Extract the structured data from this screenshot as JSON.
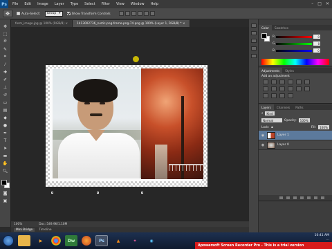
{
  "app": {
    "logo": "Ps"
  },
  "menu": [
    "File",
    "Edit",
    "Image",
    "Layer",
    "Type",
    "Select",
    "Filter",
    "View",
    "Window",
    "Help"
  ],
  "window_controls": [
    "–",
    "□",
    "✕"
  ],
  "options_bar": {
    "auto_select_label": "Auto-Select:",
    "auto_select_checked": false,
    "group_value": "Group",
    "show_transform_label": "Show Transform Controls",
    "show_transform_checked": true
  },
  "tabs": [
    {
      "label": "form_image.jpg @ 100% (RGB/8) ×",
      "active": false
    },
    {
      "label": "1413002736_rustic-png-frame-png-74.png @ 100% (Layer 1, RGB/8) * ×",
      "active": true
    }
  ],
  "status": {
    "zoom": "100%",
    "doc": "Doc: 549.9K/1.10M"
  },
  "bottom_tabs": [
    "Mini Bridge",
    "Timeline"
  ],
  "color_panel": {
    "tabs": [
      "Color",
      "Swatches"
    ],
    "channels": [
      {
        "name": "R",
        "value": "0"
      },
      {
        "name": "G",
        "value": "0"
      },
      {
        "name": "B",
        "value": "0"
      }
    ]
  },
  "adjustments_panel": {
    "tabs": [
      "Adjustments",
      "Styles"
    ],
    "title": "Add an adjustment"
  },
  "layers_panel": {
    "tabs": [
      "Layers",
      "Channels",
      "Paths"
    ],
    "kind_label": "Kind",
    "blend_mode": "Normal",
    "opacity_label": "Opacity:",
    "opacity_value": "100%",
    "lock_label": "Lock:",
    "fill_label": "Fill:",
    "fill_value": "100%",
    "layers": [
      {
        "name": "Layer 1",
        "selected": true
      },
      {
        "name": "Layer 0",
        "selected": false
      }
    ]
  },
  "taskbar": {
    "apps": [
      "Dw",
      "Ps"
    ],
    "time": "10:41 AM",
    "date": "..."
  },
  "watermark": "Apowersoft Screen Recorder Pro - This is a trial version"
}
